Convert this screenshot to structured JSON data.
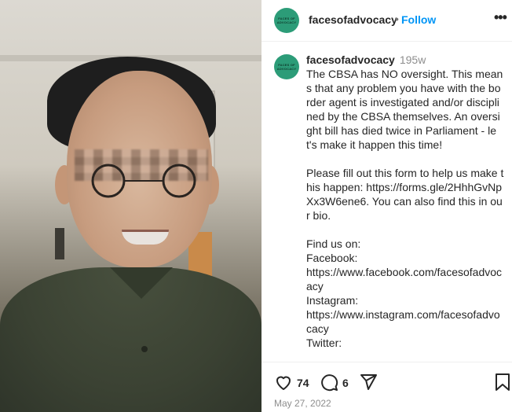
{
  "post": {
    "account": "facesofadvocacy",
    "avatar_text": "FACES OF ADVOCACY",
    "follow_label": "Follow",
    "more_icon": "•••",
    "caption_age": "195w",
    "caption": "The CBSA has NO oversight. This means that any problem you have with the border agent is investigated and/or disciplined by the CBSA themselves. An oversight bill has died twice in Parliament - let's make it happen this time!\n\nPlease fill out this form to help us make this happen: https://forms.gle/2HhhGvNpXx3W6ene6. You can also find this in our bio.\n\nFind us on:\nFacebook:\nhttps://www.facebook.com/facesofadvocacy\nInstagram:\nhttps://www.instagram.com/facesofadvocacy\nTwitter:",
    "likes": "74",
    "comments_count": "6",
    "date": "May 27, 2022"
  },
  "icons": {
    "like": "heart-icon",
    "comment": "comment-icon",
    "share": "share-icon",
    "save": "bookmark-icon"
  }
}
